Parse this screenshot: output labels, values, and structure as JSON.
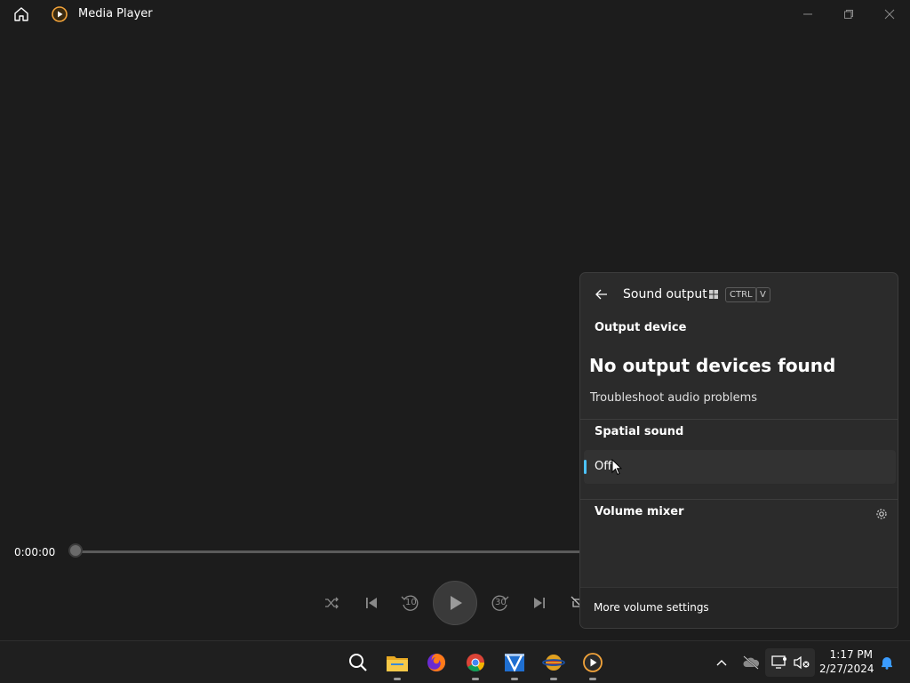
{
  "window": {
    "title": "Media Player",
    "icons": {
      "home": "home-icon",
      "app": "media-player-icon",
      "minimize": "minimize-icon",
      "maximize": "restore-icon",
      "close": "close-icon"
    }
  },
  "player": {
    "time": "0:00:00",
    "progress": 0,
    "controls": [
      "shuffle-icon",
      "previous-icon",
      "rewind-10-icon",
      "play-icon",
      "forward-30-icon",
      "next-icon",
      "repeat-icon"
    ],
    "rewind_label": "10",
    "forward_label": "30"
  },
  "sound_flyout": {
    "title": "Sound output",
    "shortcut": {
      "win_icon": "windows-logo-icon",
      "keys": [
        "CTRL",
        "V"
      ]
    },
    "output_device_label": "Output device",
    "no_devices": "No output devices found",
    "troubleshoot": "Troubleshoot audio problems",
    "spatial_label": "Spatial sound",
    "spatial_value": "Off",
    "mixer_label": "Volume mixer",
    "more_settings": "More volume settings",
    "accent_color": "#4cc2ff"
  },
  "taskbar": {
    "apps": [
      "search-icon",
      "file-explorer-icon",
      "firefox-icon",
      "chrome-icon",
      "video-editor-icon",
      "globe-app-icon",
      "media-player-icon"
    ],
    "tray": [
      "chevron-up-icon",
      "onedrive-icon",
      "network-icon",
      "sound-muted-icon",
      "notification-bell-icon"
    ],
    "clock": {
      "time": "1:17 PM",
      "date": "2/27/2024"
    }
  }
}
